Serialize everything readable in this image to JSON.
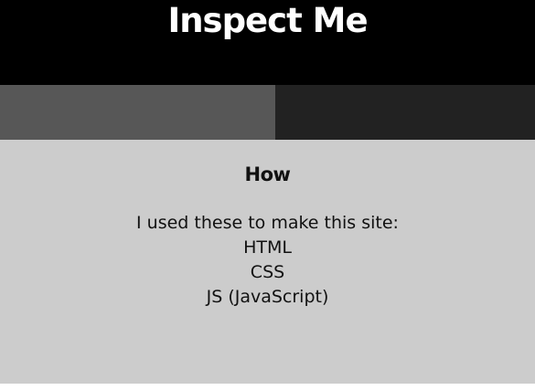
{
  "header": {
    "title": "Inspect Me"
  },
  "tabs": [
    {
      "label": "",
      "active": true,
      "color": "#575757"
    },
    {
      "label": "",
      "active": false,
      "color": "#222222"
    }
  ],
  "section": {
    "heading": "How",
    "lines": [
      "I used these to make this site:",
      "HTML",
      "CSS",
      "JS (JavaScript)"
    ]
  },
  "colors": {
    "header_bg": "#000000",
    "content_bg": "#cccccc",
    "text": "#111111"
  }
}
